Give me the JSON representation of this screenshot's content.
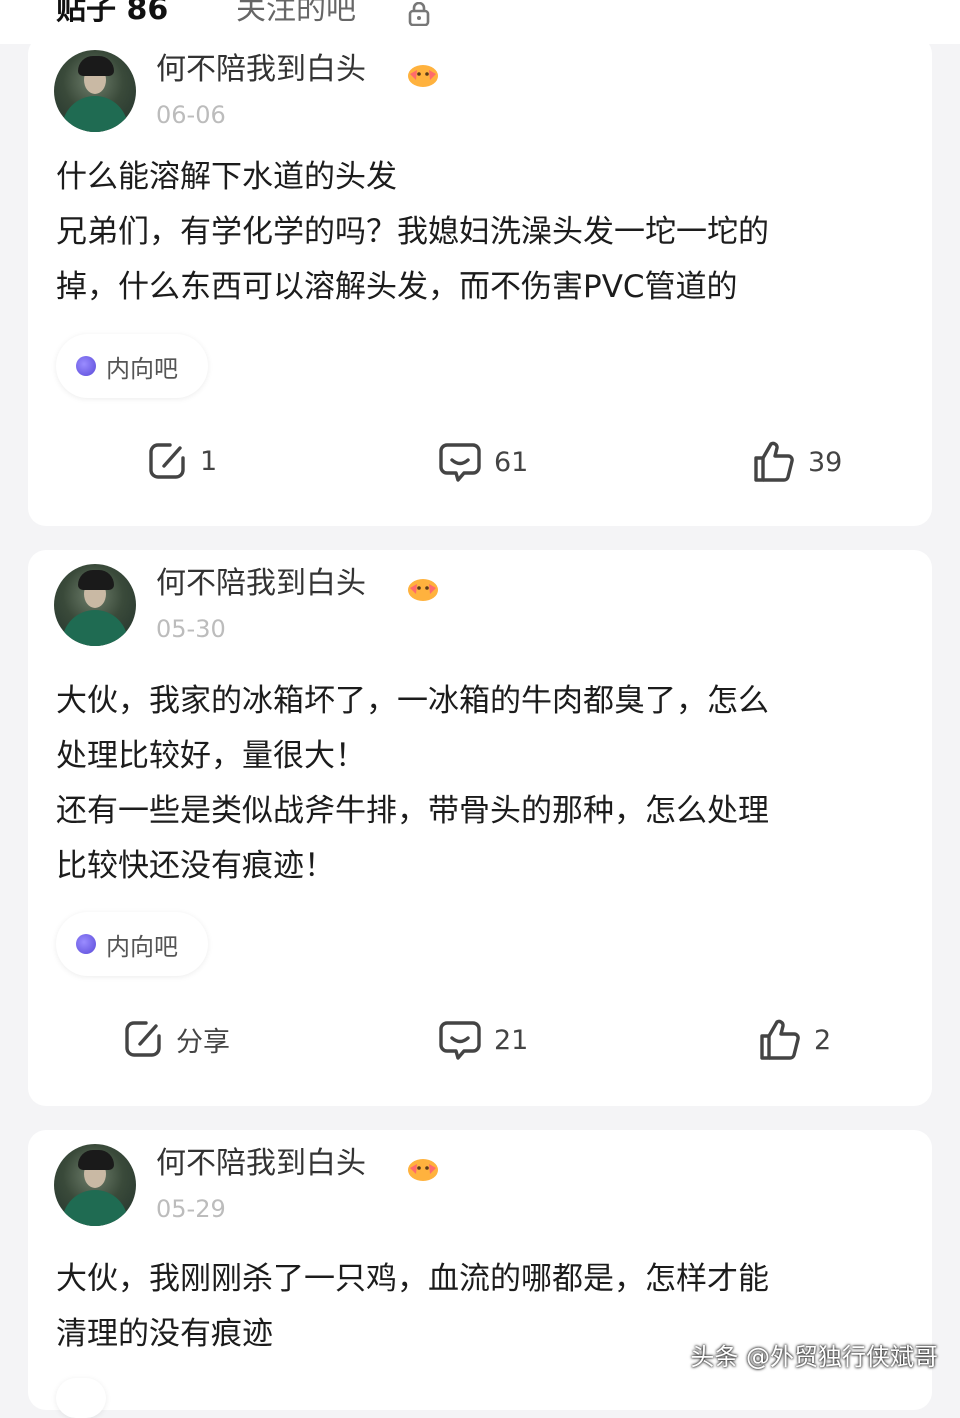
{
  "tabs": {
    "posts_label": "贴子 86",
    "follow_label": "关注的吧",
    "lock_icon": "lock-icon",
    "accent_color": "#6d5ce8"
  },
  "posts": [
    {
      "username": "何不陪我到白头",
      "date": "06-06",
      "title": "什么能溶解下水道的头发",
      "body_lines": [
        "兄弟们，有学化学的吗？我媳妇洗澡头发一坨一坨的",
        "掉，什么东西可以溶解头发，而不伤害PVC管道的"
      ],
      "tag": "内向吧",
      "share_label": "1",
      "comments": "61",
      "likes": "39"
    },
    {
      "username": "何不陪我到白头",
      "date": "05-30",
      "body_lines": [
        "大伙，我家的冰箱坏了，一冰箱的牛肉都臭了，怎么",
        "处理比较好，量很大！",
        "还有一些是类似战斧牛排，带骨头的那种，怎么处理",
        "比较快还没有痕迹！"
      ],
      "tag": "内向吧",
      "share_label": "分享",
      "comments": "21",
      "likes": "2"
    },
    {
      "username": "何不陪我到白头",
      "date": "05-29",
      "body_lines": [
        "大伙，我刚刚杀了一只鸡，血流的哪都是，怎样才能",
        "清理的没有痕迹"
      ]
    }
  ],
  "watermark": "头条 @外贸独行侠斌哥"
}
